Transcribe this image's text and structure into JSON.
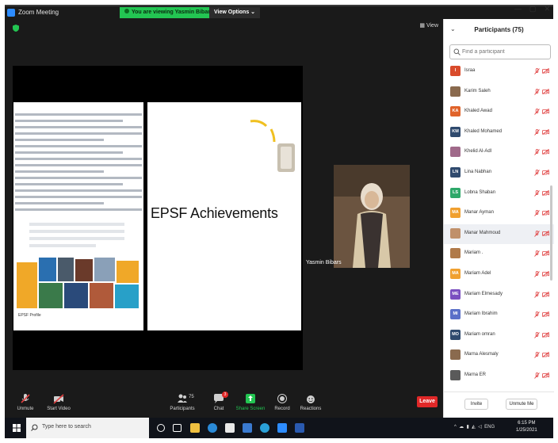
{
  "titlebar": {
    "app_title": "Zoom Meeting",
    "viewing_banner": "You are viewing Yasmin Bibars' screen",
    "view_options": "View Options ⌄"
  },
  "meeting": {
    "view_label": "▦ View",
    "slide_title": "EPSF Achievements",
    "epsf_profile": "EPSF Profile",
    "presenter_name": "Yasmin Bibars"
  },
  "controls": {
    "unmute": "Unmute",
    "start_video": "Start Video",
    "participants": "Participants",
    "participants_count": "75",
    "chat": "Chat",
    "chat_badge": "3",
    "share_screen": "Share Screen",
    "record": "Record",
    "reactions": "Reactions",
    "leave": "Leave"
  },
  "panel": {
    "title": "Participants (75)",
    "search_placeholder": "Find a participant",
    "invite": "Invite",
    "unmute_me": "Unmute Me",
    "participants": [
      {
        "name": "Israa",
        "initials": "I",
        "color": "#d94b2b",
        "photo": false
      },
      {
        "name": "Karim Saleh",
        "initials": "",
        "color": "#8a6a4e",
        "photo": true
      },
      {
        "name": "Khaled Awad",
        "initials": "KA",
        "color": "#e0632a",
        "photo": false
      },
      {
        "name": "Khaled Mohamed",
        "initials": "KM",
        "color": "#2f4a6e",
        "photo": false
      },
      {
        "name": "Khelid Al-Adl",
        "initials": "",
        "color": "#a06a8a",
        "photo": true
      },
      {
        "name": "Lina Nabhan",
        "initials": "LN",
        "color": "#2f4a6e",
        "photo": false
      },
      {
        "name": "Lobna Shaban",
        "initials": "LS",
        "color": "#2fa86a",
        "photo": false
      },
      {
        "name": "Manar Ayman",
        "initials": "MA",
        "color": "#f0a030",
        "photo": false
      },
      {
        "name": "Manar Mahmoud",
        "initials": "",
        "color": "#c0906a",
        "photo": true
      },
      {
        "name": "Mariam .",
        "initials": "",
        "color": "#b07a4a",
        "photo": true
      },
      {
        "name": "Mariam Adel",
        "initials": "MA",
        "color": "#f0a030",
        "photo": false
      },
      {
        "name": "Mariam Elmesady",
        "initials": "ME",
        "color": "#7a4fc0",
        "photo": false
      },
      {
        "name": "Mariam Ibrahim",
        "initials": "MI",
        "color": "#5a6fc8",
        "photo": false
      },
      {
        "name": "Mariam omran",
        "initials": "MO",
        "color": "#2f4a6e",
        "photo": false
      },
      {
        "name": "Marna Alesmaly",
        "initials": "",
        "color": "#8a6a4e",
        "photo": true
      },
      {
        "name": "Marna ER",
        "initials": "",
        "color": "#5a5a5a",
        "photo": true
      }
    ]
  },
  "taskbar": {
    "search_placeholder": "Type here to search",
    "language": "ENG",
    "time": "6:15 PM",
    "date": "1/25/2021"
  },
  "colors": {
    "zoom_blue": "#2d8cff",
    "banner_green": "#23c552",
    "leave_red": "#e02828",
    "muted_red": "#e04040",
    "dark_bg": "#1a1a1a"
  }
}
